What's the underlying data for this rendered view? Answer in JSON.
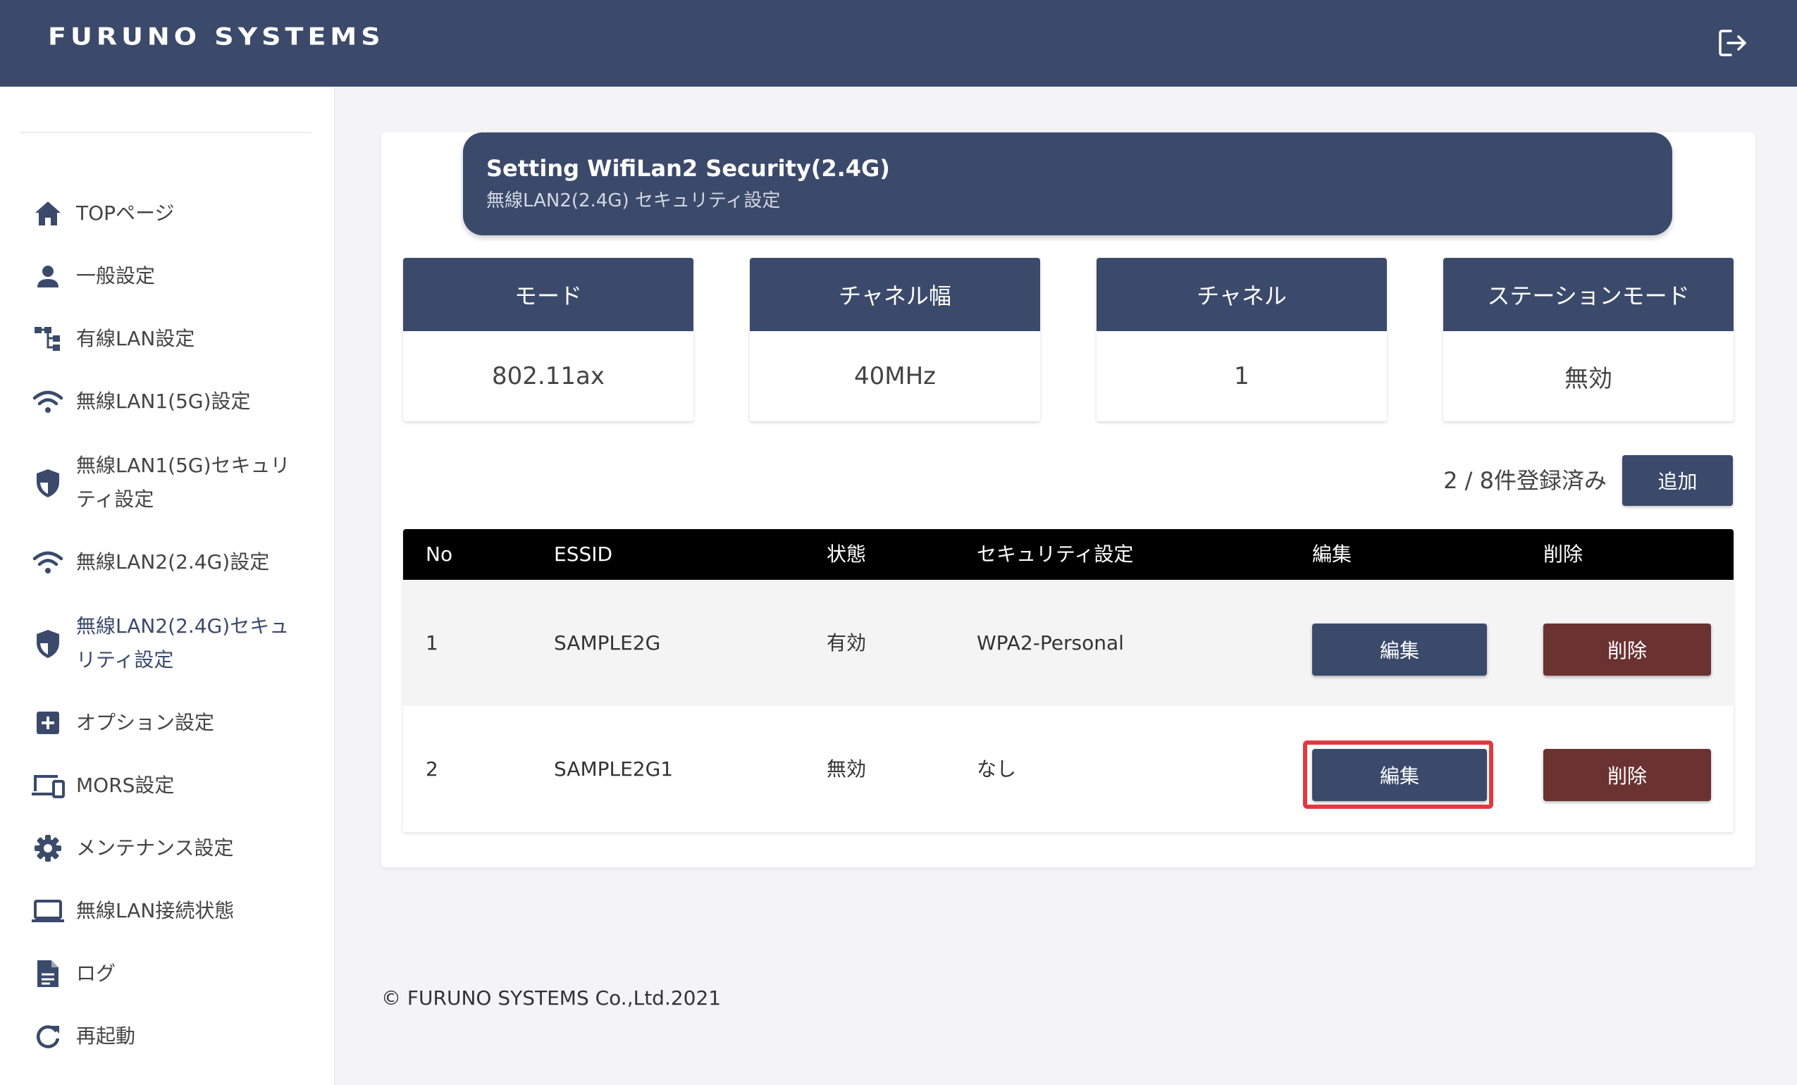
{
  "header": {
    "logo": "FURUNO SYSTEMS",
    "logout_icon": "logout-icon"
  },
  "sidebar": {
    "items": [
      {
        "label": "TOPページ",
        "icon": "home-icon"
      },
      {
        "label": "一般設定",
        "icon": "person-icon"
      },
      {
        "label": "有線LAN設定",
        "icon": "network-tree-icon"
      },
      {
        "label": "無線LAN1(5G)設定",
        "icon": "wifi-icon"
      },
      {
        "label": "無線LAN1(5G)セキュリティ設定",
        "icon": "shield-icon"
      },
      {
        "label": "無線LAN2(2.4G)設定",
        "icon": "wifi-icon"
      },
      {
        "label": "無線LAN2(2.4G)セキュリティ設定",
        "icon": "shield-icon"
      },
      {
        "label": "オプション設定",
        "icon": "plus-box-icon"
      },
      {
        "label": "MORS設定",
        "icon": "devices-icon"
      },
      {
        "label": "メンテナンス設定",
        "icon": "gear-icon"
      },
      {
        "label": "無線LAN接続状態",
        "icon": "laptop-icon"
      },
      {
        "label": "ログ",
        "icon": "document-icon"
      },
      {
        "label": "再起動",
        "icon": "refresh-icon"
      }
    ]
  },
  "page": {
    "title_en": "Setting WifiLan2 Security(2.4G)",
    "title_ja": "無線LAN2(2.4G) セキュリティ設定"
  },
  "info_cards": [
    {
      "label": "モード",
      "value": "802.11ax"
    },
    {
      "label": "チャネル幅",
      "value": "40MHz"
    },
    {
      "label": "チャネル",
      "value": "1"
    },
    {
      "label": "ステーションモード",
      "value": "無効"
    }
  ],
  "registration": {
    "count_text": "2 / 8件登録済み",
    "add_label": "追加"
  },
  "table": {
    "headers": [
      "No",
      "ESSID",
      "状態",
      "セキュリティ設定",
      "編集",
      "削除"
    ],
    "rows": [
      {
        "no": "1",
        "essid": "SAMPLE2G",
        "status": "有効",
        "security": "WPA2-Personal",
        "edit": "編集",
        "delete": "削除"
      },
      {
        "no": "2",
        "essid": "SAMPLE2G1",
        "status": "無効",
        "security": "なし",
        "edit": "編集",
        "delete": "削除"
      }
    ]
  },
  "colors": {
    "primary": "#3b4a6b",
    "delete": "#6b3232",
    "highlight": "#e03a40"
  },
  "footer": {
    "copyright": "© FURUNO SYSTEMS Co.,Ltd.2021"
  }
}
